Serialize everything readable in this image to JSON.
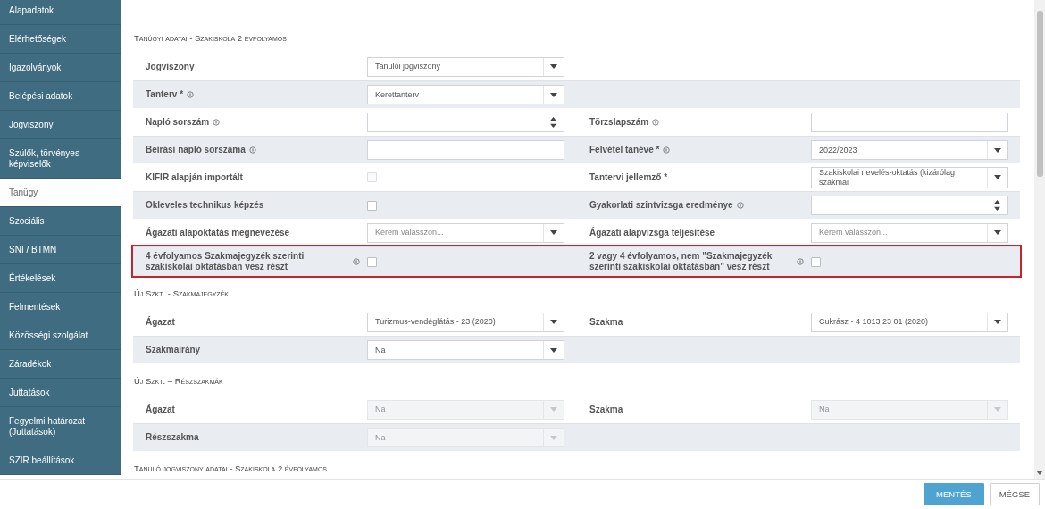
{
  "sidebar": {
    "items": [
      {
        "label": "Alapadatok",
        "selected": false
      },
      {
        "label": "Elérhetőségek",
        "selected": false
      },
      {
        "label": "Igazolványok",
        "selected": false
      },
      {
        "label": "Belépési adatok",
        "selected": false
      },
      {
        "label": "Jogviszony",
        "selected": false
      },
      {
        "label": "Szülők, törvényes képviselők",
        "selected": false
      },
      {
        "label": "Tanügy",
        "selected": true
      },
      {
        "label": "Szociális",
        "selected": false
      },
      {
        "label": "SNI / BTMN",
        "selected": false
      },
      {
        "label": "Értékelések",
        "selected": false
      },
      {
        "label": "Felmentések",
        "selected": false
      },
      {
        "label": "Közösségi szolgálat",
        "selected": false
      },
      {
        "label": "Záradékok",
        "selected": false
      },
      {
        "label": "Juttatások",
        "selected": false
      },
      {
        "label": "Fegyelmi határozat (Juttatások)",
        "selected": false
      },
      {
        "label": "SZIR beállítások",
        "selected": false
      }
    ]
  },
  "sections": [
    {
      "title": "Tanúgyi adatai - Szakiskola 2 évfolyamos",
      "rows": [
        {
          "highlighted": false,
          "fields": [
            {
              "label": "Jogviszony",
              "info": false,
              "control": {
                "kind": "select",
                "value": "Tanulói jogviszony",
                "disabled": false
              }
            }
          ]
        },
        {
          "highlighted": false,
          "fields": [
            {
              "label": "Tanterv *",
              "info": true,
              "control": {
                "kind": "select",
                "value": "Kerettanterv",
                "disabled": false
              }
            }
          ]
        },
        {
          "highlighted": false,
          "fields": [
            {
              "label": "Napló sorszám",
              "info": true,
              "control": {
                "kind": "number",
                "disabled": false
              }
            },
            {
              "label": "Törzslapszám",
              "info": true,
              "control": {
                "kind": "text",
                "disabled": false
              }
            }
          ]
        },
        {
          "highlighted": false,
          "fields": [
            {
              "label": "Beírási napló sorszáma",
              "info": true,
              "control": {
                "kind": "text",
                "disabled": false
              }
            },
            {
              "label": "Felvétel tanéve *",
              "info": true,
              "control": {
                "kind": "select",
                "value": "2022/2023",
                "disabled": false
              }
            }
          ]
        },
        {
          "highlighted": false,
          "fields": [
            {
              "label": "KIFIR alapján importált",
              "info": false,
              "control": {
                "kind": "checkbox",
                "checked": false,
                "disabled": true
              }
            },
            {
              "label": "Tantervi jellemző *",
              "info": false,
              "control": {
                "kind": "select",
                "value": "Szakiskolai nevelés-oktatás (kizárólag szakmai",
                "disabled": false
              }
            }
          ]
        },
        {
          "highlighted": false,
          "fields": [
            {
              "label": "Okleveles technikus képzés",
              "info": false,
              "control": {
                "kind": "checkbox",
                "checked": false,
                "disabled": false
              }
            },
            {
              "label": "Gyakorlati szintvizsga eredménye",
              "info": true,
              "control": {
                "kind": "number",
                "disabled": false
              }
            }
          ]
        },
        {
          "highlighted": false,
          "fields": [
            {
              "label": "Ágazati alapoktatás megnevezése",
              "info": false,
              "control": {
                "kind": "select",
                "placeholder": "Kérem válasszon...",
                "disabled": false
              }
            },
            {
              "label": "Ágazati alapvizsga teljesítése",
              "info": false,
              "control": {
                "kind": "select",
                "placeholder": "Kérem válasszon...",
                "disabled": false
              }
            }
          ]
        },
        {
          "highlighted": true,
          "fields": [
            {
              "label": "4 évfolyamos Szakmajegyzék szerinti szakiskolai oktatásban vesz részt",
              "info": true,
              "control": {
                "kind": "checkbox",
                "checked": false,
                "disabled": false
              }
            },
            {
              "label": "2 vagy 4 évfolyamos, nem \"Szakmajegyzék szerinti szakiskolai oktatásban\" vesz részt",
              "info": true,
              "control": {
                "kind": "checkbox",
                "checked": false,
                "disabled": false
              }
            }
          ]
        }
      ]
    },
    {
      "title": "Új Szkt. - Szakmajegyzék",
      "rows": [
        {
          "highlighted": false,
          "fields": [
            {
              "label": "Ágazat",
              "info": false,
              "control": {
                "kind": "select",
                "value": "Turizmus-vendéglátás - 23 (2020)",
                "disabled": false
              }
            },
            {
              "label": "Szakma",
              "info": false,
              "control": {
                "kind": "select",
                "value": "Cukrász - 4 1013 23 01 (2020)",
                "disabled": false
              }
            }
          ]
        },
        {
          "highlighted": false,
          "fields": [
            {
              "label": "Szakmairány",
              "info": false,
              "control": {
                "kind": "select",
                "value": "Na",
                "disabled": false
              }
            }
          ]
        }
      ]
    },
    {
      "title": "Új Szkt. – Részszakmák",
      "rows": [
        {
          "highlighted": false,
          "fields": [
            {
              "label": "Ágazat",
              "info": false,
              "control": {
                "kind": "select",
                "value": "Na",
                "disabled": true
              }
            },
            {
              "label": "Szakma",
              "info": false,
              "control": {
                "kind": "select",
                "value": "Na",
                "disabled": true
              }
            }
          ]
        },
        {
          "highlighted": false,
          "fields": [
            {
              "label": "Részszakma",
              "info": false,
              "control": {
                "kind": "select",
                "value": "Na",
                "disabled": true
              }
            }
          ]
        }
      ]
    },
    {
      "title": "Tanuló jogviszony adatai - Szakiskola 2 évfolyamos"
    }
  ],
  "footer": {
    "buttons": [
      {
        "label": "MENTÉS",
        "kind": "primary"
      },
      {
        "label": "MÉGSE",
        "kind": "secondary"
      }
    ]
  }
}
